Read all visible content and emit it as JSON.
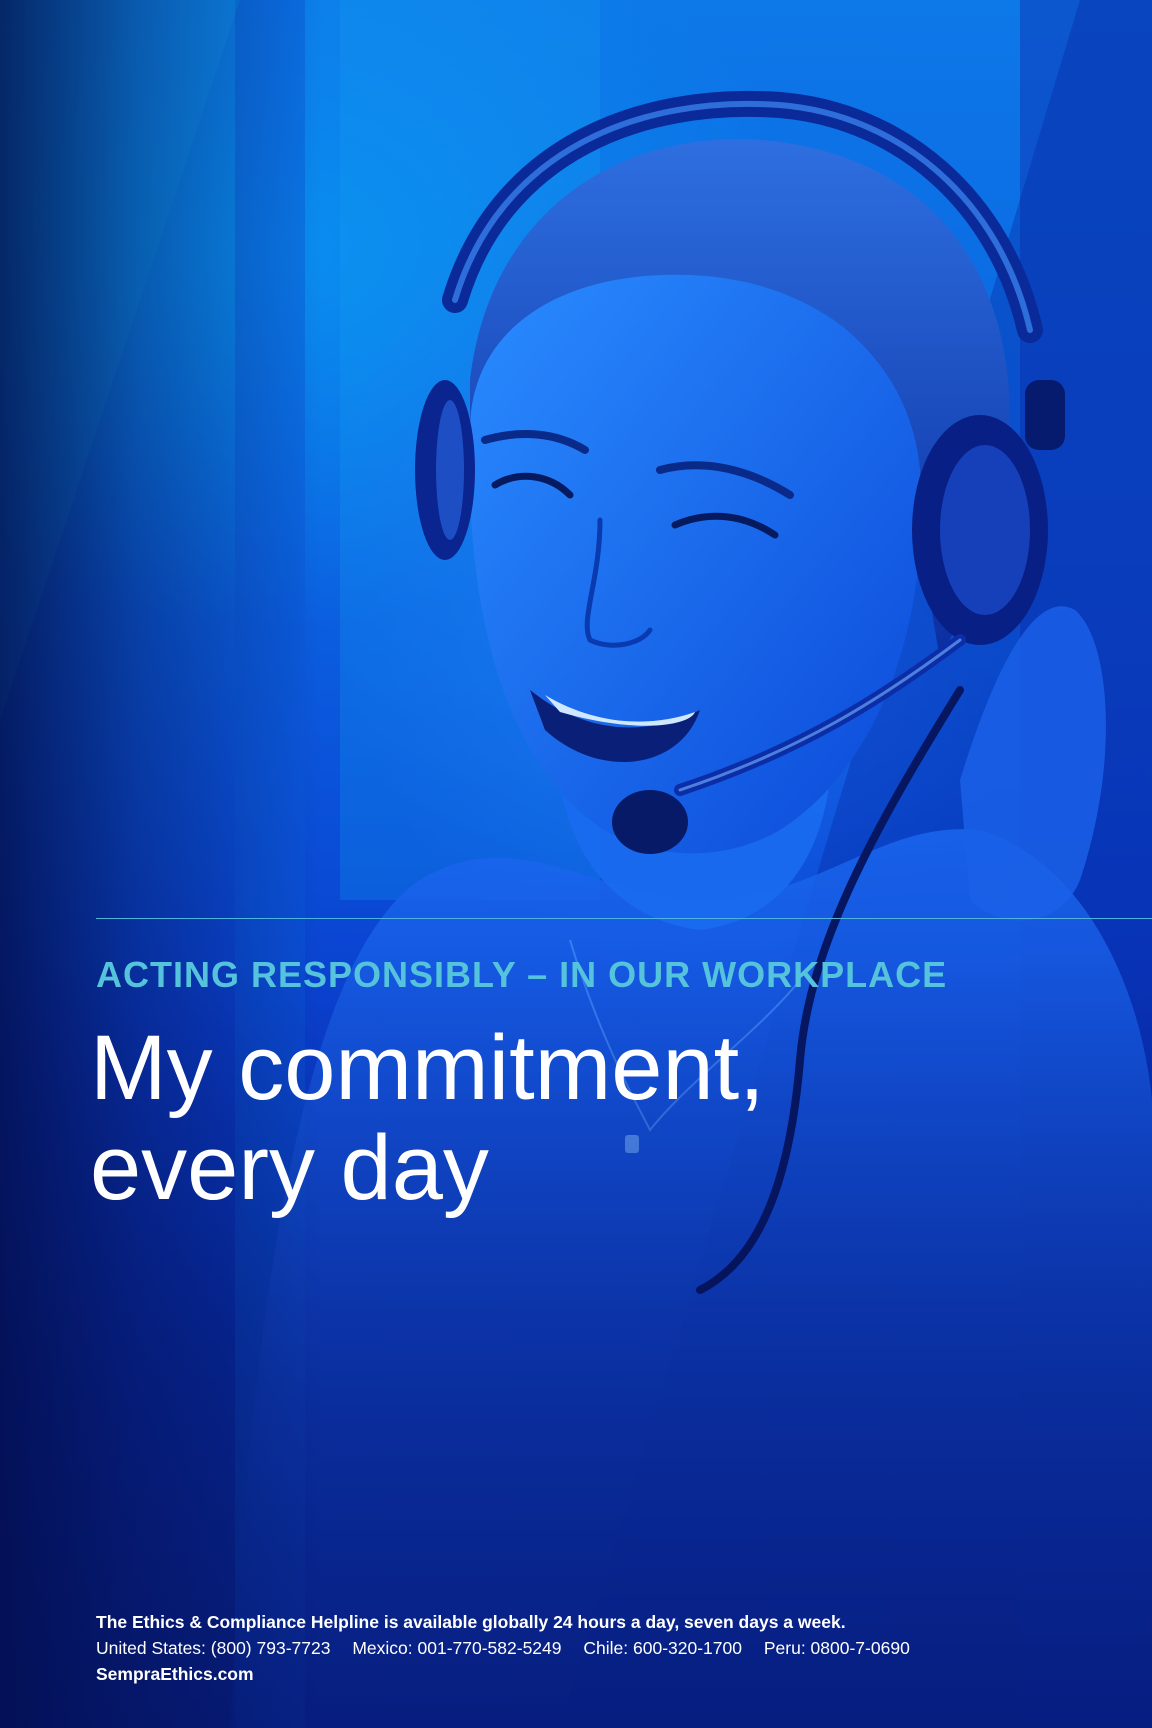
{
  "poster": {
    "section_label": "ACTING RESPONSIBLY – IN OUR WORKPLACE",
    "headline_line1": "My commitment,",
    "headline_line2": "every day"
  },
  "footer": {
    "availability": "The Ethics & Compliance Helpline is available globally 24 hours a day, seven days a week.",
    "phones": [
      "United States: (800) 793-7723",
      "Mexico: 001-770-582-5249",
      "Chile: 600-320-1700",
      "Peru: 0800-7-0690"
    ],
    "website": "SempraEthics.com"
  },
  "colors": {
    "background_blue": "#0b5fe0",
    "accent_cyan": "#56c3dc",
    "text_white": "#ffffff"
  }
}
